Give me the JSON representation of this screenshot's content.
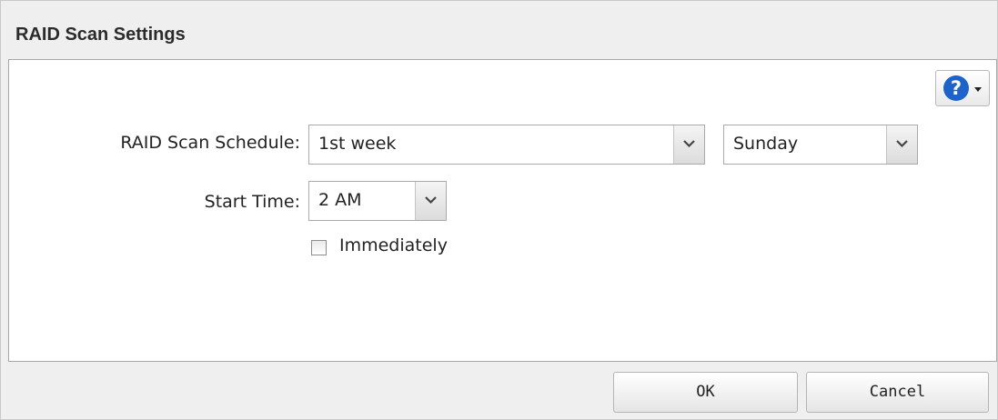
{
  "dialog": {
    "title": "RAID Scan Settings"
  },
  "help": {
    "icon": "question-icon",
    "glyph": "?"
  },
  "form": {
    "schedule_label": "RAID Scan Schedule:",
    "week_value": "1st week",
    "day_value": "Sunday",
    "start_time_label": "Start Time:",
    "start_time_value": "2 AM",
    "immediately_label": "Immediately",
    "immediately_checked": false
  },
  "footer": {
    "ok_label": "OK",
    "cancel_label": "Cancel"
  },
  "colors": {
    "help_icon_bg": "#1e63c9",
    "dialog_bg": "#efefef",
    "panel_bg": "#ffffff"
  }
}
